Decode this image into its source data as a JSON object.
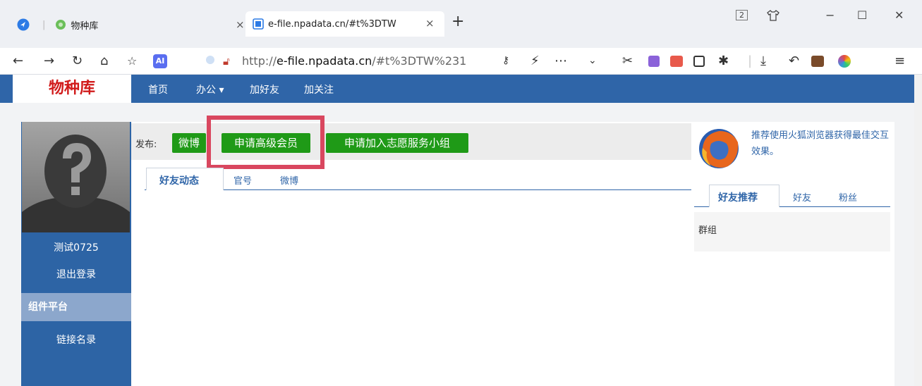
{
  "browser": {
    "tabs": [
      {
        "title": "物种库",
        "close": "×"
      },
      {
        "title": "e-file.npadata.cn/#t%3DTW",
        "close": "×"
      }
    ],
    "new_tab": "+",
    "window": {
      "tab_count": "2",
      "minimize": "−",
      "maximize": "☐",
      "close": "✕"
    },
    "url_prefix": "http://",
    "url_host": "e-file.npadata.cn",
    "url_rest": "/#t%3DTW%231",
    "ai_badge": "AI"
  },
  "site": {
    "brand": "物种库",
    "nav": [
      "首页",
      "办公 ▾",
      "加好友",
      "加关注"
    ],
    "accent_color": "#2f65a8",
    "brand_color": "#d11b1b"
  },
  "left": {
    "username": "测试0725",
    "logout": "退出登录",
    "section": "组件平台",
    "link": "链接名录"
  },
  "center": {
    "publish_label": "发布:",
    "buttons": [
      "微博",
      "申请高级会员",
      "申请加入志愿服务小组"
    ],
    "button_color": "#1f9a17",
    "highlight_color": "#d9475f",
    "tabs": [
      "好友动态",
      "官号",
      "微博"
    ]
  },
  "right": {
    "firefox_tip": "推荐使用火狐浏览器获得最佳交互效果。",
    "tabs": [
      "好友推荐",
      "好友",
      "粉丝"
    ],
    "group_label": "群组"
  }
}
